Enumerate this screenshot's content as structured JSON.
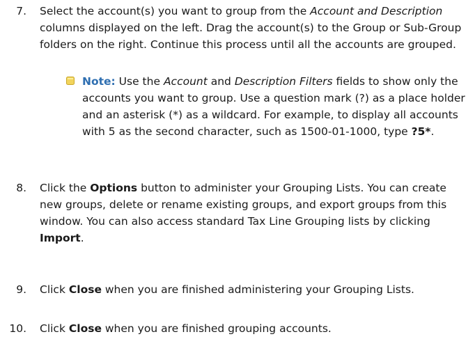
{
  "step7": {
    "number": "7.",
    "p1": "Select the account(s) you want to group from the ",
    "em1": "Account and Description",
    "p2": " columns displayed on the left. Drag the account(s) to the Group or Sub-Group folders on the right. Continue this process until all the accounts are grouped."
  },
  "note": {
    "label": "Note:",
    "p1": " Use the ",
    "em1": "Account",
    "p2": " and ",
    "em2": "Description Filters",
    "p3": " fields to show only the accounts you want to group. Use a question mark (?) as a place holder and an asterisk (*) as a wildcard. For example, to display all accounts with 5 as the second character, such as 1500-01-1000, type ",
    "code": "?5*",
    "p4": "."
  },
  "step8": {
    "number": "8.",
    "p1": "Click the ",
    "b1": "Options",
    "p2": " button to administer your Grouping Lists. You can create new groups, delete or rename existing groups, and export groups from this window. You can also access standard Tax Line Grouping lists by clicking ",
    "b2": "Import",
    "p3": "."
  },
  "step9": {
    "number": "9.",
    "p1": "Click ",
    "b1": "Close",
    "p2": " when you are finished administering your Grouping Lists."
  },
  "step10": {
    "number": "10.",
    "p1": "Click ",
    "b1": "Close",
    "p2": " when you are finished grouping accounts."
  },
  "colors": {
    "note_label": "#2f6fb1",
    "note_icon": "#f2d45c"
  }
}
